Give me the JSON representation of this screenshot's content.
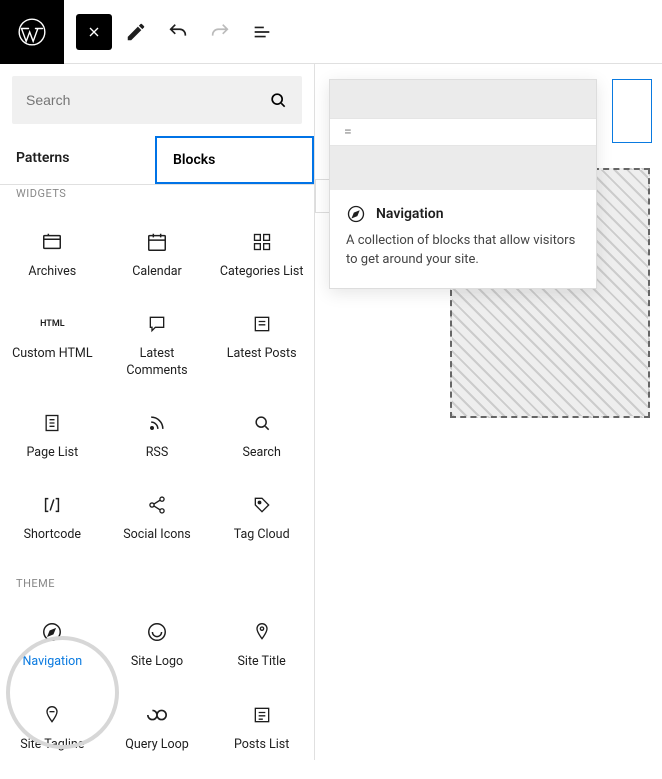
{
  "search": {
    "placeholder": "Search"
  },
  "tabs": {
    "patterns": "Patterns",
    "blocks": "Blocks"
  },
  "sections": {
    "widgets": "WIDGETS",
    "theme": "THEME"
  },
  "widgets": {
    "archives": "Archives",
    "calendar": "Calendar",
    "categories": "Categories List",
    "customhtml": "Custom HTML",
    "latestcomments": "Latest Comments",
    "latestposts": "Latest Posts",
    "pagelist": "Page List",
    "rss": "RSS",
    "search": "Search",
    "shortcode": "Shortcode",
    "socialicons": "Social Icons",
    "tagcloud": "Tag Cloud"
  },
  "theme": {
    "navigation": "Navigation",
    "sitelogo": "Site Logo",
    "sitetitle": "Site Title",
    "sitetagline": "Site Tagline",
    "queryloop": "Query Loop",
    "postslist": "Posts List"
  },
  "tooltip": {
    "title": "Navigation",
    "desc": "A collection of blocks that allow visitors to get around your site."
  }
}
